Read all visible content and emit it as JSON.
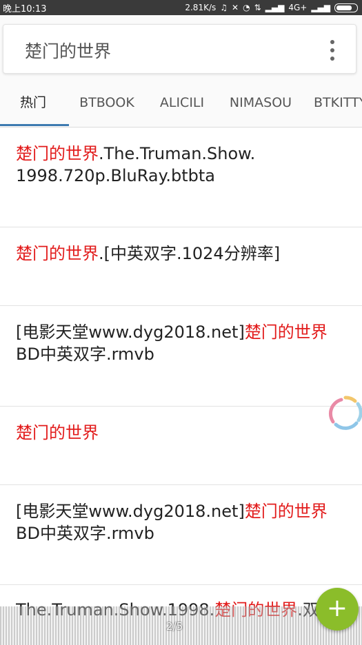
{
  "status": {
    "time": "晚上10:13",
    "speed": "2.81K/s",
    "network": "4G+"
  },
  "search": {
    "query": "楚门的世界",
    "more_icon": "more-vert-icon"
  },
  "tabs": [
    "热门",
    "BTBOOK",
    "ALICILI",
    "NIMASOU",
    "BTKITTY"
  ],
  "results": [
    {
      "hl": "楚门的世界",
      "post": ".The.Truman.Show.",
      "line2": "1998.720p.BluRay.btbta"
    },
    {
      "hl": "楚门的世界",
      "post": ".[中英双字.1024分辨率]"
    },
    {
      "pre": "[电影天堂www.dyg2018.net]",
      "hl": "楚门的世界",
      "line2": "BD中英双字.rmvb"
    },
    {
      "hl": "楚门的世界"
    },
    {
      "pre": "[电影天堂www.dyg2018.net]",
      "hl": "楚门的世界",
      "line2": "BD中英双字.rmvb"
    },
    {
      "pre": "The.Truman.Show.1998.",
      "hl": "楚门的世界",
      "post": ".双"
    }
  ],
  "colors": {
    "highlight": "#e21b1b",
    "accent": "#3d7ab0",
    "fab": "#8bbd2a"
  },
  "fab": {
    "label": "+"
  },
  "page_indicator": "2/5"
}
